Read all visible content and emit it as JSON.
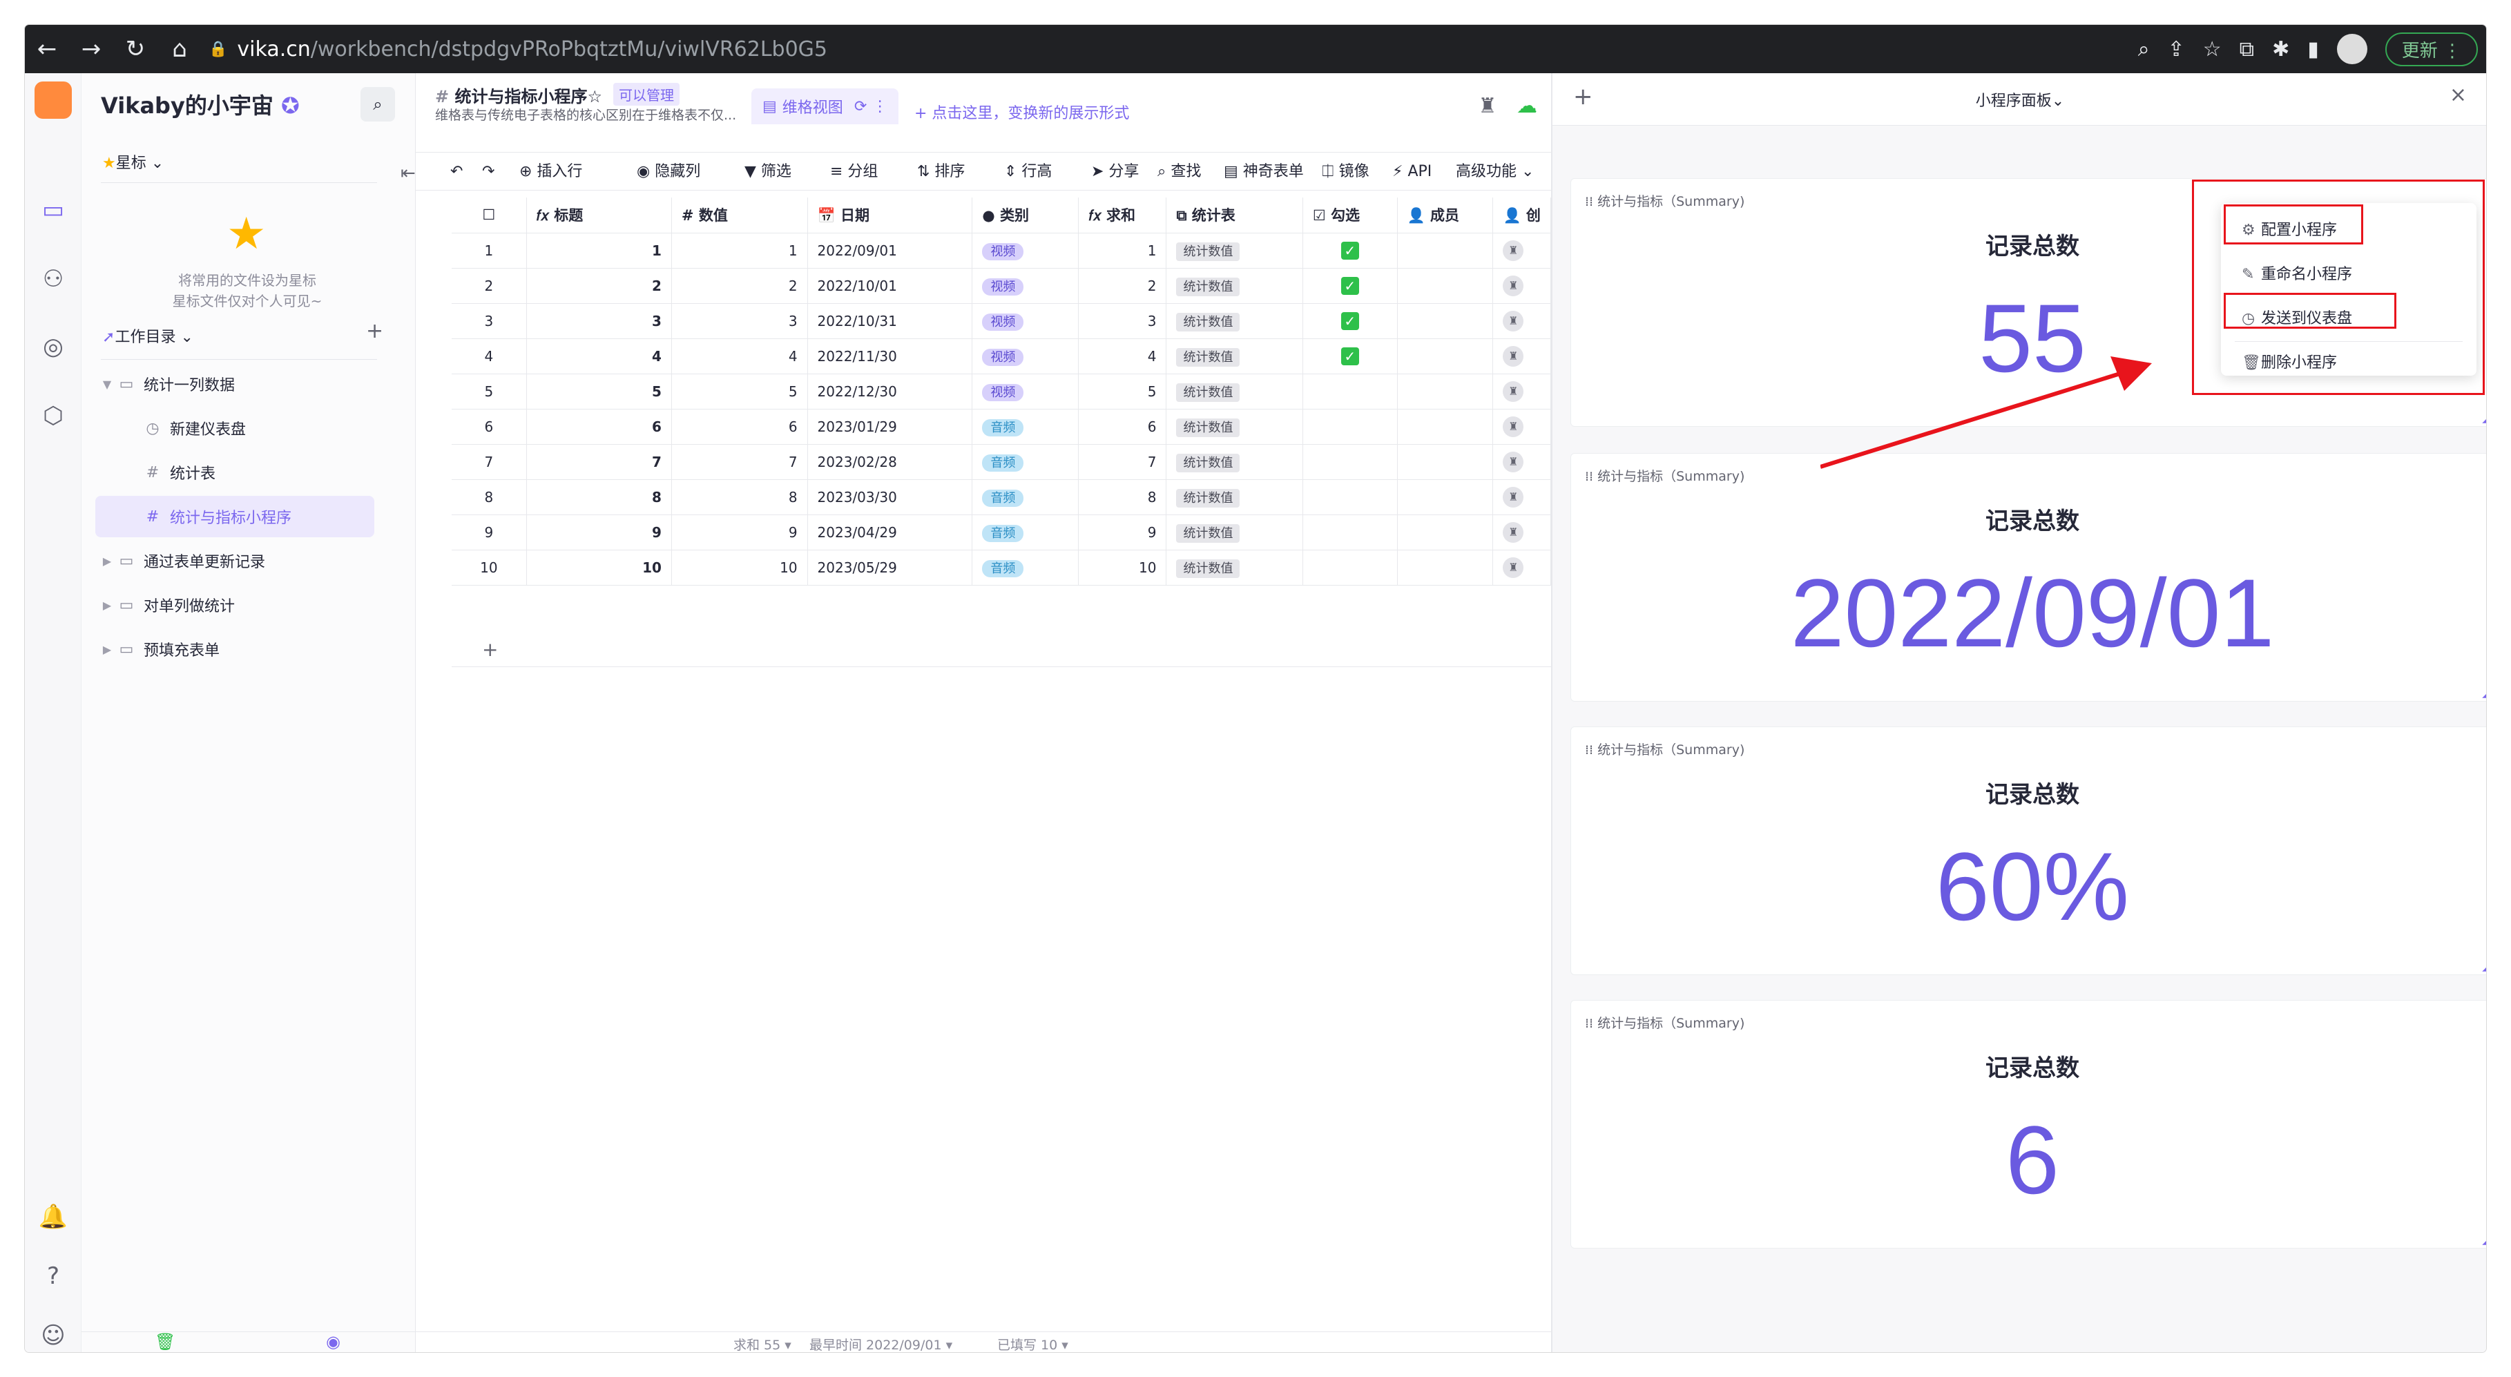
{
  "browser": {
    "url_host": "vika.cn",
    "url_path": "/workbench/dstpdgvPRoPbqtztMu/viwlVR62Lb0G5",
    "update_label": "更新"
  },
  "sidebar": {
    "space_name": "Vikaby的小宇宙",
    "star_label": "星标",
    "star_hint_1": "将常用的文件设为星标",
    "star_hint_2": "星标文件仅对个人可见~",
    "workdir_label": "工作目录",
    "tree": [
      {
        "label": "统计一列数据"
      },
      {
        "label": "新建仪表盘"
      },
      {
        "label": "统计表"
      },
      {
        "label": "统计与指标小程序"
      },
      {
        "label": "通过表单更新记录"
      },
      {
        "label": "对单列做统计"
      },
      {
        "label": "预填充表单"
      }
    ]
  },
  "sheet": {
    "title": "统计与指标小程序☆",
    "perm": "可以管理",
    "desc": "维格表与传统电子表格的核心区别在于维格表不仅...",
    "view_tab": "维格视图",
    "add_view": "+ 点击这里，变换新的展示形式",
    "toolbar": {
      "insert": "⊕ 插入行",
      "hide": "◉ 隐藏列",
      "filter": "▼ 筛选",
      "group": "≡ 分组",
      "sort": "⇅ 排序",
      "height": "⇕ 行高",
      "share": "➤ 分享",
      "find": "⌕ 查找",
      "form": "▤ 神奇表单",
      "mirror": "⎅ 镜像",
      "api": "⚡ API",
      "advanced": "高级功能 ⌄"
    },
    "columns": [
      "𝑓𝑥 标题",
      "# 数值",
      "📅 日期",
      "● 类别",
      "𝑓𝑥 求和",
      "⧉ 统计表",
      "☑ 勾选",
      "👤 成员",
      "👤 创"
    ],
    "rows": [
      {
        "n": "1",
        "title": "1",
        "val": "1",
        "date": "2022/09/01",
        "cat": "视频",
        "sum": "1",
        "link": "统计数值",
        "chk": true
      },
      {
        "n": "2",
        "title": "2",
        "val": "2",
        "date": "2022/10/01",
        "cat": "视频",
        "sum": "2",
        "link": "统计数值",
        "chk": true
      },
      {
        "n": "3",
        "title": "3",
        "val": "3",
        "date": "2022/10/31",
        "cat": "视频",
        "sum": "3",
        "link": "统计数值",
        "chk": true
      },
      {
        "n": "4",
        "title": "4",
        "val": "4",
        "date": "2022/11/30",
        "cat": "视频",
        "sum": "4",
        "link": "统计数值",
        "chk": true
      },
      {
        "n": "5",
        "title": "5",
        "val": "5",
        "date": "2022/12/30",
        "cat": "视频",
        "sum": "5",
        "link": "统计数值",
        "chk": false
      },
      {
        "n": "6",
        "title": "6",
        "val": "6",
        "date": "2023/01/29",
        "cat": "音频",
        "sum": "6",
        "link": "统计数值",
        "chk": false
      },
      {
        "n": "7",
        "title": "7",
        "val": "7",
        "date": "2023/02/28",
        "cat": "音频",
        "sum": "7",
        "link": "统计数值",
        "chk": false
      },
      {
        "n": "8",
        "title": "8",
        "val": "8",
        "date": "2023/03/30",
        "cat": "音频",
        "sum": "8",
        "link": "统计数值",
        "chk": false
      },
      {
        "n": "9",
        "title": "9",
        "val": "9",
        "date": "2023/04/29",
        "cat": "音频",
        "sum": "9",
        "link": "统计数值",
        "chk": false
      },
      {
        "n": "10",
        "title": "10",
        "val": "10",
        "date": "2023/05/29",
        "cat": "音频",
        "sum": "10",
        "link": "统计数值",
        "chk": false
      }
    ],
    "stats": {
      "sum": "求和 55 ▾",
      "earliest": "最早时间 2022/09/01 ▾",
      "filled": "已填写 10 ▾"
    }
  },
  "panel": {
    "title": "小程序面板⌄",
    "widgets": [
      {
        "name": "统计与指标（Summary)",
        "label": "记录总数",
        "value": "55"
      },
      {
        "name": "统计与指标（Summary)",
        "label": "记录总数",
        "value": "2022/09/01"
      },
      {
        "name": "统计与指标（Summary)",
        "label": "记录总数",
        "value": "60%"
      },
      {
        "name": "统计与指标（Summary)",
        "label": "记录总数",
        "value": "6"
      }
    ],
    "menu": {
      "configure": "配置小程序",
      "rename": "重命名小程序",
      "send": "发送到仪表盘",
      "delete": "删除小程序"
    }
  },
  "colors": {
    "accent": "#7b67ee",
    "value": "#6a5ae0",
    "highlight": "#e8141c"
  }
}
